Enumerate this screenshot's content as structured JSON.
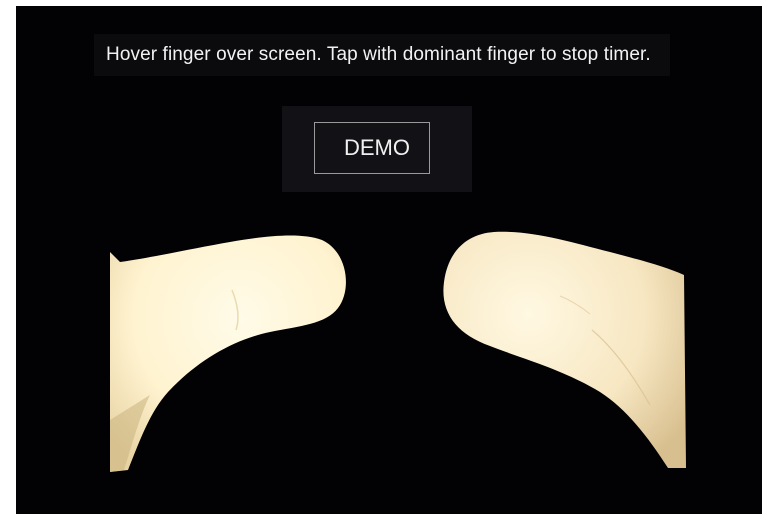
{
  "screen": {
    "instruction": "Hover finger over screen. Tap with dominant finger to stop timer.",
    "demo_button_label": "DEMO"
  },
  "colors": {
    "screen_background": "#020205",
    "text": "#f2f2f2",
    "button_border": "#9a9a9a",
    "finger_skin": "#fff4d6"
  }
}
